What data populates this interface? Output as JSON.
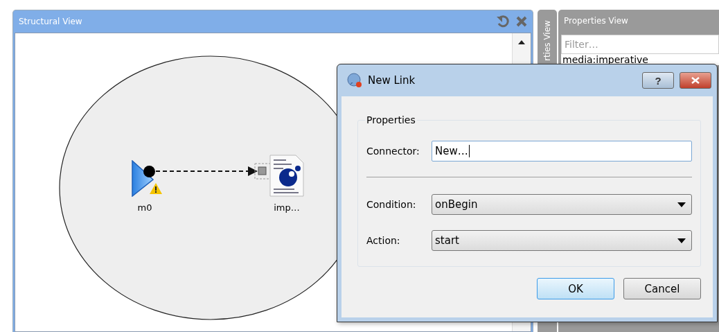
{
  "structural_view": {
    "title": "Structural View",
    "nodes": [
      {
        "kind": "media",
        "label": "m0",
        "warning": true
      },
      {
        "kind": "script",
        "label": "imp…",
        "warning": false
      }
    ]
  },
  "properties_view": {
    "tab_label": "rties View",
    "title": "Properties View",
    "filter": {
      "placeholder": "Filter…"
    },
    "items": [
      "media:imperative"
    ]
  },
  "dialog": {
    "title": "New Link",
    "help": "?",
    "group": "Properties",
    "fields": [
      {
        "kind": "text",
        "label": "Connector:",
        "value": "New…"
      },
      {
        "kind": "combo",
        "label": "Condition:",
        "value": "onBegin"
      },
      {
        "kind": "combo",
        "label": "Action:",
        "value": "start"
      }
    ],
    "buttons": [
      {
        "label": "OK",
        "default": true
      },
      {
        "label": "Cancel",
        "default": false
      }
    ]
  }
}
